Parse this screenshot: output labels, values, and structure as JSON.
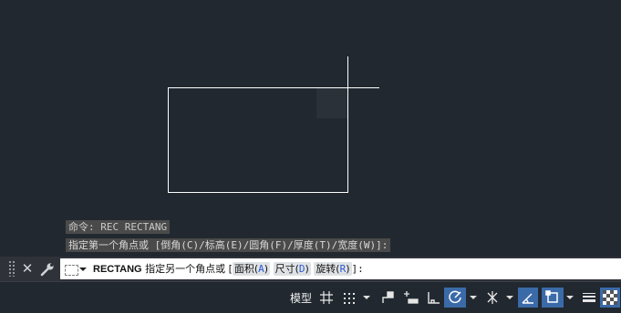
{
  "history": {
    "line1": "命令: REC RECTANG",
    "line2": "指定第一个角点或 [倒角(C)/标高(E)/圆角(F)/厚度(T)/宽度(W)]:"
  },
  "command_line": {
    "command": "RECTANG",
    "prompt": " 指定另一个角点或 [",
    "options": [
      {
        "label": "面积(",
        "key": "A",
        "close": ")"
      },
      {
        "label": "尺寸(",
        "key": "D",
        "close": ")"
      },
      {
        "label": "旋转(",
        "key": "R",
        "close": ")"
      }
    ],
    "suffix": "]:"
  },
  "toolbar": {
    "close_glyph": "✕"
  },
  "statusbar": {
    "model_label": "模型",
    "buttons": [
      "grid-icon",
      "snap-icon",
      "infer-constraints-icon",
      "dynamic-input-icon",
      "ortho-icon",
      "polar-tracking-icon",
      "isometric-icon",
      "object-snap-tracking-icon",
      "object-snap-icon",
      "lineweight-icon",
      "transparency-icon"
    ]
  },
  "colors": {
    "canvas": "#212830",
    "geometry": "#ffffff",
    "active_toggle": "#3b6aa8"
  }
}
